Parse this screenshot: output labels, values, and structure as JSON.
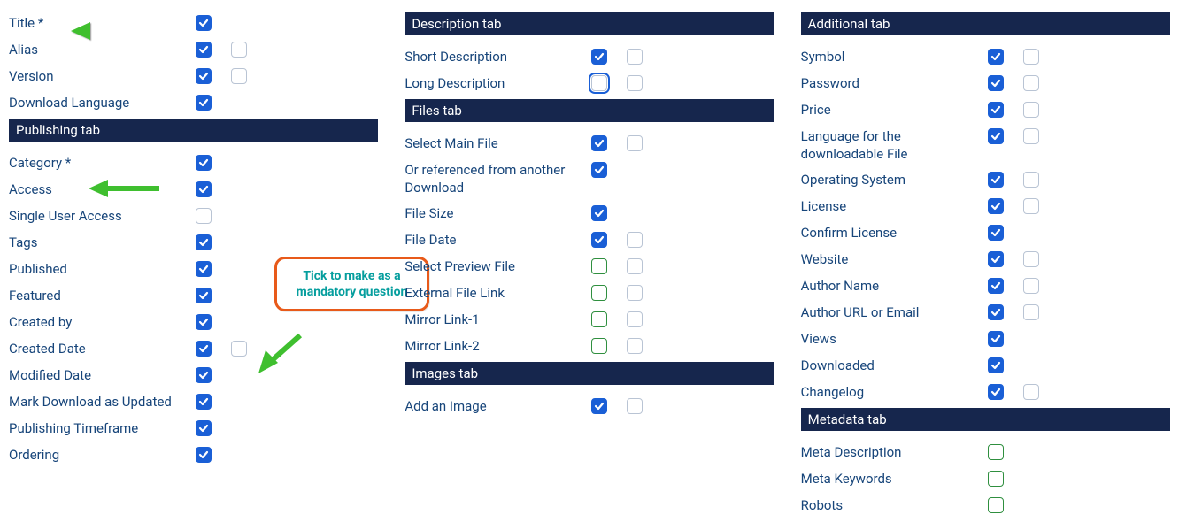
{
  "column1": {
    "items_top": [
      {
        "label": "Title *",
        "c1": true,
        "c2": null
      },
      {
        "label": "Alias",
        "c1": true,
        "c2": false
      },
      {
        "label": "Version",
        "c1": true,
        "c2": false
      },
      {
        "label": "Download Language",
        "c1": true,
        "c2": null
      }
    ],
    "header_publishing": "Publishing tab",
    "items_pub": [
      {
        "label": "Category *",
        "c1": true,
        "c2": null
      },
      {
        "label": "Access",
        "c1": true,
        "c2": null
      },
      {
        "label": "Single User Access",
        "c1": false,
        "c2": null
      },
      {
        "label": "Tags",
        "c1": true,
        "c2": null
      },
      {
        "label": "Published",
        "c1": true,
        "c2": null
      },
      {
        "label": "Featured",
        "c1": true,
        "c2": null
      },
      {
        "label": "Created by",
        "c1": true,
        "c2": null
      },
      {
        "label": "Created Date",
        "c1": true,
        "c2": false
      },
      {
        "label": "Modified Date",
        "c1": true,
        "c2": null
      },
      {
        "label": "Mark Download as Updated",
        "c1": true,
        "c2": null
      },
      {
        "label": "Publishing Timeframe",
        "c1": true,
        "c2": null
      },
      {
        "label": "Ordering",
        "c1": true,
        "c2": null
      }
    ]
  },
  "column2": {
    "header_desc": "Description tab",
    "items_desc": [
      {
        "label": "Short Description",
        "c1": true,
        "c2": false
      },
      {
        "label": "Long Description",
        "c1": false,
        "c2": false,
        "c1_focus": true
      }
    ],
    "header_files": "Files tab",
    "items_files": [
      {
        "label": "Select Main File",
        "c1": true,
        "c2": false
      },
      {
        "label": "Or referenced from another Download",
        "c1": true,
        "c2": null
      },
      {
        "label": "File Size",
        "c1": true,
        "c2": null
      },
      {
        "label": "File Date",
        "c1": true,
        "c2": false
      },
      {
        "label": "Select Preview File",
        "c1": false,
        "c2": false,
        "c1_green": true
      },
      {
        "label": "External File Link",
        "c1": false,
        "c2": false,
        "c1_green": true
      },
      {
        "label": "Mirror Link-1",
        "c1": false,
        "c2": false,
        "c1_green": true
      },
      {
        "label": "Mirror Link-2",
        "c1": false,
        "c2": false,
        "c1_green": true
      }
    ],
    "header_images": "Images tab",
    "items_images": [
      {
        "label": "Add an Image",
        "c1": true,
        "c2": false
      }
    ]
  },
  "column3": {
    "header_add": "Additional tab",
    "items_add": [
      {
        "label": "Symbol",
        "c1": true,
        "c2": false
      },
      {
        "label": "Password",
        "c1": true,
        "c2": false
      },
      {
        "label": "Price",
        "c1": true,
        "c2": false
      },
      {
        "label": "Language for the downloadable File",
        "c1": true,
        "c2": false
      },
      {
        "label": "Operating System",
        "c1": true,
        "c2": false
      },
      {
        "label": "License",
        "c1": true,
        "c2": false
      },
      {
        "label": "Confirm License",
        "c1": true,
        "c2": null
      },
      {
        "label": "Website",
        "c1": true,
        "c2": false
      },
      {
        "label": "Author Name",
        "c1": true,
        "c2": false
      },
      {
        "label": "Author URL or Email",
        "c1": true,
        "c2": false
      },
      {
        "label": "Views",
        "c1": true,
        "c2": null
      },
      {
        "label": "Downloaded",
        "c1": true,
        "c2": null
      },
      {
        "label": "Changelog",
        "c1": true,
        "c2": false
      }
    ],
    "header_meta": "Metadata tab",
    "items_meta": [
      {
        "label": "Meta Description",
        "c1": false,
        "c2": null,
        "c1_green": true
      },
      {
        "label": "Meta Keywords",
        "c1": false,
        "c2": null,
        "c1_green": true
      },
      {
        "label": "Robots",
        "c1": false,
        "c2": null,
        "c1_green": true
      }
    ]
  },
  "callout_text": "Tick to make as a mandatory question"
}
